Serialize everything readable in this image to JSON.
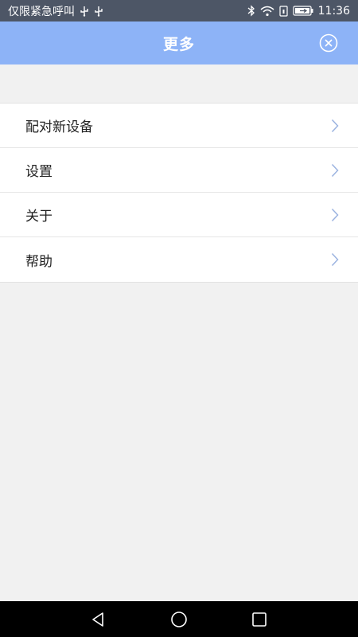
{
  "status_bar": {
    "carrier_text": "仅限紧急呼叫",
    "time": "11:36",
    "icons": [
      "usb-icon",
      "usb-icon",
      "bluetooth-icon",
      "wifi-icon",
      "sim-icon",
      "battery-icon"
    ]
  },
  "header": {
    "title": "更多",
    "background_color": "#8db3f7",
    "close_icon": "close-circle-icon"
  },
  "menu": {
    "items": [
      {
        "label": "配对新设备",
        "icon": "chevron-right-icon"
      },
      {
        "label": "设置",
        "icon": "chevron-right-icon"
      },
      {
        "label": "关于",
        "icon": "chevron-right-icon"
      },
      {
        "label": "帮助",
        "icon": "chevron-right-icon"
      }
    ]
  },
  "nav_bar": {
    "buttons": [
      "back-icon",
      "home-icon",
      "recents-icon"
    ]
  }
}
